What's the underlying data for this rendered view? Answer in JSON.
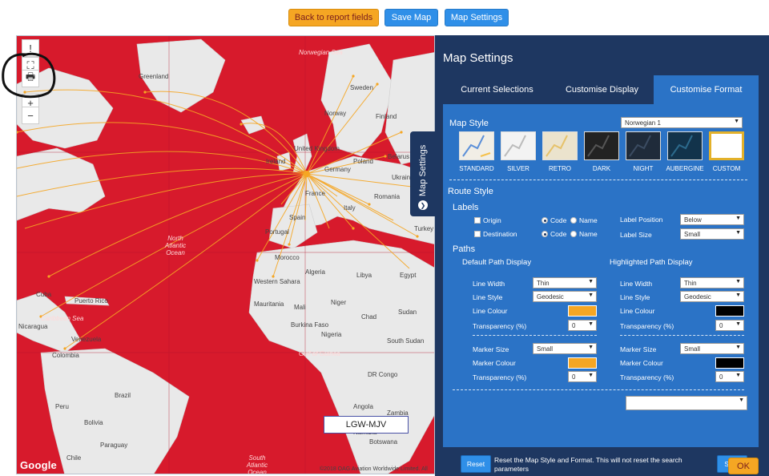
{
  "toolbar": {
    "back_label": "Back to report fields",
    "save_map_label": "Save Map",
    "map_settings_label": "Map Settings"
  },
  "map": {
    "controls": [
      {
        "name": "info-icon",
        "glyph": "!"
      },
      {
        "name": "fullscreen-icon",
        "glyph": "⛶"
      },
      {
        "name": "print-icon",
        "glyph": "🖶"
      },
      {
        "name": "zoom-in-icon",
        "glyph": "+"
      },
      {
        "name": "zoom-out-icon",
        "glyph": "−"
      }
    ],
    "labels": {
      "greenland": "Greenland",
      "norwegian_sea": "Norwegian Sea",
      "sweden": "Sweden",
      "norway": "Norway",
      "finland": "Finland",
      "united_kingdom": "United Kingdom",
      "ireland": "Ireland",
      "germany": "Germany",
      "poland": "Poland",
      "belarus": "Belarus",
      "ukraine": "Ukraine",
      "france": "France",
      "romania": "Romania",
      "spain": "Spain",
      "portugal": "Portugal",
      "italy": "Italy",
      "turkey": "Turkey",
      "morocco": "Morocco",
      "algeria": "Algeria",
      "libya": "Libya",
      "egypt": "Egypt",
      "western_sahara": "Western Sahara",
      "mauritania": "Mauritania",
      "mali": "Mali",
      "niger": "Niger",
      "chad": "Chad",
      "sudan": "Sudan",
      "burkina_faso": "Burkina Faso",
      "nigeria": "Nigeria",
      "gulf_of_guinea": "Gulf of Guinea",
      "south_sudan": "South Sudan",
      "dr_congo": "DR Congo",
      "angola": "Angola",
      "zambia": "Zambia",
      "namibia": "Namibia",
      "botswana": "Botswana",
      "north_atlantic": "North Atlantic Ocean",
      "south_atlantic": "South Atlantic Ocean",
      "caribbean_sea": "Caribbean Sea",
      "venezuela": "Venezuela",
      "colombia": "Colombia",
      "brazil": "Brazil",
      "peru": "Peru",
      "bolivia": "Bolivia",
      "paraguay": "Paraguay",
      "chile": "Chile",
      "cuba": "Cuba",
      "nicaragua": "Nicaragua",
      "puerto_rico": "Puerto Rico"
    },
    "google": "Google",
    "copyright": "©2018 OAG Aviation Worldwide Limited. All",
    "registration": "LGW-MJV",
    "side_tab_label": "Map Settings"
  },
  "panel": {
    "title": "Map Settings",
    "tabs": [
      "Current Selections",
      "Customise Display",
      "Customise Format"
    ],
    "map_style": {
      "heading": "Map Style",
      "selected": "Norwegian 1",
      "styles": [
        "STANDARD",
        "SILVER",
        "RETRO",
        "DARK",
        "NIGHT",
        "AUBERGINE",
        "CUSTOM"
      ]
    },
    "route_style": {
      "heading": "Route Style",
      "labels_heading": "Labels",
      "origin": "Origin",
      "destination": "Destination",
      "code": "Code",
      "name": "Name",
      "label_position": "Label Position",
      "label_position_value": "Below",
      "label_size": "Label Size",
      "label_size_value": "Small"
    },
    "paths": {
      "heading": "Paths",
      "default_heading": "Default Path Display",
      "highlighted_heading": "Highlighted Path Display",
      "line_width": "Line Width",
      "line_style": "Line Style",
      "line_colour": "Line Colour",
      "transparency": "Transparency (%)",
      "marker_size": "Marker Size",
      "marker_colour": "Marker Colour",
      "default": {
        "line_width": "Thin",
        "line_style": "Geodesic",
        "line_colour": "#f5a623",
        "transparency": "0",
        "marker_size": "Small",
        "marker_colour": "#f5a623",
        "marker_transparency": "0"
      },
      "highlighted": {
        "line_width": "Thin",
        "line_style": "Geodesic",
        "line_colour": "#000000",
        "transparency": "0",
        "marker_size": "Small",
        "marker_colour": "#000000",
        "marker_transparency": "0"
      }
    },
    "bottom_select": "",
    "reset_label": "Reset",
    "reset_text": "Reset the Map Style and Format. This will not reset the search parameters",
    "save_label": "Save"
  },
  "ok_label": "OK",
  "colors": {
    "map_land": "#d71a2c",
    "route": "#f5a623",
    "panel": "#1e3761",
    "accent": "#2b73c6"
  }
}
